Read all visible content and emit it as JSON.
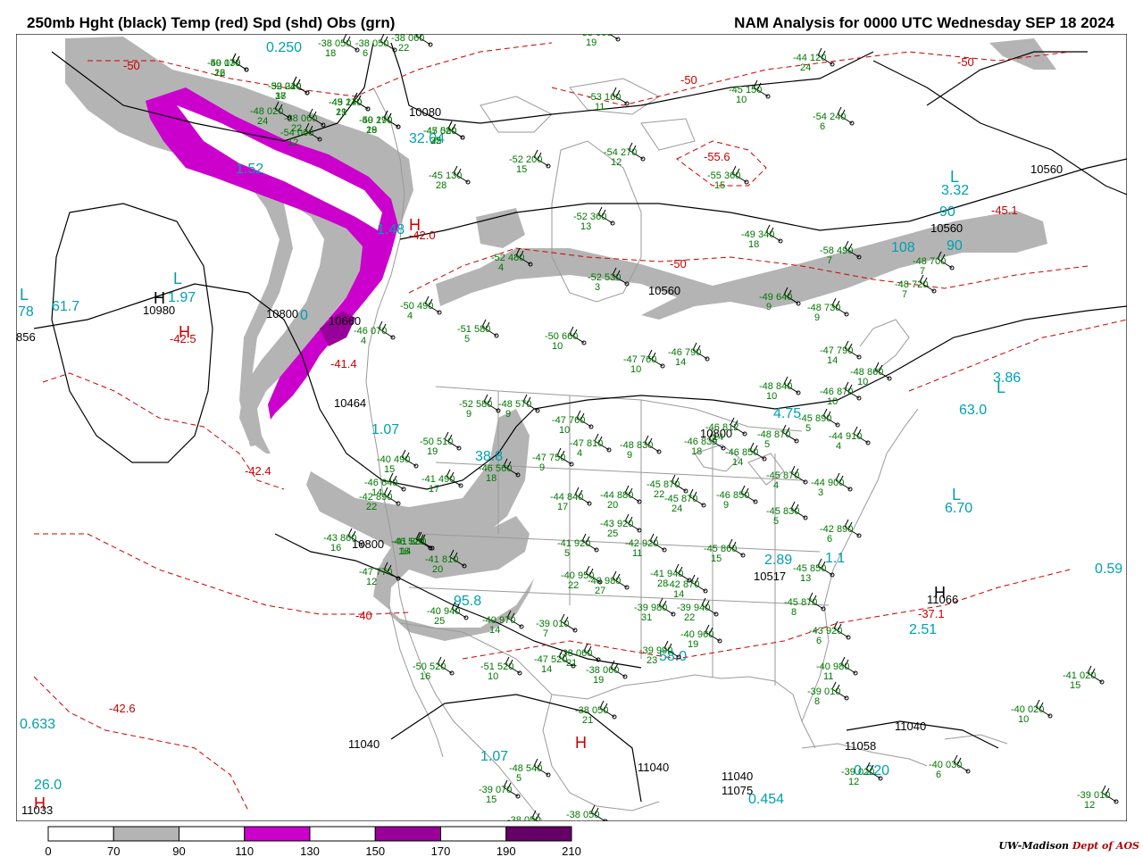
{
  "header": {
    "title_left": "250mb Hght (black) Temp (red) Spd (shd) Obs (grn)",
    "title_right": "NAM Analysis for 0000 UTC Wednesday  SEP 18 2024"
  },
  "legend": {
    "ticks": [
      "0",
      "70",
      "90",
      "110",
      "130",
      "150",
      "170",
      "190",
      "210"
    ],
    "colors": [
      "#ffffff",
      "#b4b4b4",
      "#ffffff",
      "#cc00cc",
      "#ffffff",
      "#990099",
      "#ffffff",
      "#660066"
    ]
  },
  "credit": {
    "institution": "UW-Madison",
    "dept": "Dept of AOS"
  },
  "colors": {
    "height_contours": "#000000",
    "temperature_contours": "#cc0000",
    "observations": "#007700",
    "speed_labels": "#00a0b0",
    "geography": "#9a9a9a",
    "jet_70_90": "#b4b4b4",
    "jet_110_130": "#cc00cc",
    "jet_150_170": "#990099"
  },
  "height_labels": [
    "10560",
    "10560",
    "10560",
    "10800",
    "10800",
    "10800",
    "10980",
    "11040",
    "11040",
    "11040",
    "11040",
    "10080",
    "10660",
    "10464",
    "10517",
    "11066",
    "11058",
    "11075",
    "11033",
    "856"
  ],
  "temperature_labels": [
    "-50",
    "-50",
    "-50",
    "-50",
    "-55.6",
    "-45.1",
    "-42.0",
    "-42.5",
    "-41.4",
    "-42.4",
    "-40",
    "-42.6",
    "-37.1"
  ],
  "hl_markers": [
    "H",
    "H",
    "H",
    "H",
    "H",
    "H",
    "L",
    "L",
    "L",
    "L",
    "L"
  ],
  "speed_labels": [
    "0.250",
    "1.52",
    "1.97",
    "61.7",
    "78",
    "1.48",
    "0",
    "3.32",
    "90",
    "108",
    "90",
    "3.86",
    "63.0",
    "4.75",
    "1.07",
    "38.8",
    "6.70",
    "0.59",
    "2.89",
    "1.1",
    "95.8",
    "58.0",
    "2.51",
    "0.633",
    "26.0",
    "1.07",
    "0.220",
    "0.454",
    "32.04"
  ],
  "observations": [
    [
      "-49 136",
      "26"
    ],
    [
      "-39 040",
      "37"
    ],
    [
      "-45 140",
      "19"
    ],
    [
      "-49 170",
      "19"
    ],
    [
      "-45 080",
      "32"
    ],
    [
      "-45 130",
      "28"
    ],
    [
      "-52 200",
      "15"
    ],
    [
      "-53 160",
      "11"
    ],
    [
      "-54 270",
      "12"
    ],
    [
      "-54 240",
      "6"
    ],
    [
      "-44 120",
      "24"
    ],
    [
      "-45 150",
      "10"
    ],
    [
      "-55 360",
      "15"
    ],
    [
      "-52 360",
      "13"
    ],
    [
      "-49 340",
      "18"
    ],
    [
      "-58 490",
      "7"
    ],
    [
      "-48 700",
      "7"
    ],
    [
      "-48 720",
      "7"
    ],
    [
      "-49 640",
      "9"
    ],
    [
      "-48 730",
      "9"
    ],
    [
      "-52 480",
      "4"
    ],
    [
      "-52 530",
      "3"
    ],
    [
      "-50 490",
      "4"
    ],
    [
      "-51 580",
      "5"
    ],
    [
      "-50 660",
      "10"
    ],
    [
      "-47 760",
      "10"
    ],
    [
      "-46 790",
      "14"
    ],
    [
      "-47 790",
      "14"
    ],
    [
      "-48 860",
      "10"
    ],
    [
      "-48 840",
      "10"
    ],
    [
      "-46 870",
      "10"
    ],
    [
      "-45 890",
      "5"
    ],
    [
      "-48 870",
      "5"
    ],
    [
      "-44 910",
      "4"
    ],
    [
      "-44 900",
      "3"
    ],
    [
      "-45 870",
      "4"
    ],
    [
      "-45 830",
      "5"
    ],
    [
      "-42 890",
      "6"
    ],
    [
      "-45 850",
      "13"
    ],
    [
      "-45 870",
      "8"
    ],
    [
      "-43 920",
      "6"
    ],
    [
      "-40 980",
      "11"
    ],
    [
      "-39 010",
      "8"
    ],
    [
      "-41 020",
      "15"
    ],
    [
      "-40 020",
      "10"
    ],
    [
      "-39 020",
      "12"
    ],
    [
      "-40 030",
      "6"
    ],
    [
      "-39 010",
      "12"
    ],
    [
      "-52 580",
      "9"
    ],
    [
      "-48 570",
      "9"
    ],
    [
      "-47 760",
      "10"
    ],
    [
      "-47 810",
      "4"
    ],
    [
      "-48 830",
      "9"
    ],
    [
      "-46 839",
      "18"
    ],
    [
      "-46 812",
      "14"
    ],
    [
      "-46 850",
      "14"
    ],
    [
      "-45 870",
      "22"
    ],
    [
      "-45 870",
      "24"
    ],
    [
      "-46 850",
      "9"
    ],
    [
      "-45 860",
      "15"
    ],
    [
      "-42 870",
      "14"
    ],
    [
      "-50 510",
      "19"
    ],
    [
      "-46 560",
      "18"
    ],
    [
      "-47 750",
      "9"
    ],
    [
      "-44 840",
      "17"
    ],
    [
      "-44 880",
      "20"
    ],
    [
      "-43 920",
      "25"
    ],
    [
      "-41 920",
      "5"
    ],
    [
      "-42 920",
      "11"
    ],
    [
      "-41 940",
      "28"
    ],
    [
      "-40 950",
      "22"
    ],
    [
      "-40 980",
      "27"
    ],
    [
      "-39 980",
      "31"
    ],
    [
      "-39 940",
      "22"
    ],
    [
      "-40 960",
      "19"
    ],
    [
      "-39 990",
      "23"
    ],
    [
      "-38 060",
      "21"
    ],
    [
      "-38 060",
      "19"
    ],
    [
      "-38 050",
      "21"
    ],
    [
      "-39 010",
      "7"
    ],
    [
      "-40 970",
      "14"
    ],
    [
      "-40 940",
      "25"
    ],
    [
      "-41 810",
      "20"
    ],
    [
      "-41 880",
      "14"
    ],
    [
      "-43 860",
      "16"
    ],
    [
      "-41 490",
      "17"
    ],
    [
      "-47 770",
      "12"
    ],
    [
      "-46 520",
      "16"
    ],
    [
      "-46 640",
      "14"
    ],
    [
      "-40 490",
      "15"
    ],
    [
      "-42 890",
      "22"
    ],
    [
      "-50 520",
      "16"
    ],
    [
      "-51 520",
      "10"
    ],
    [
      "-47 520",
      "14"
    ],
    [
      "-48 540",
      "5"
    ],
    [
      "-39 070",
      "15"
    ],
    [
      "-38 050",
      "17"
    ],
    [
      "-38 050",
      "21"
    ],
    [
      "-38 060",
      "22"
    ],
    [
      "-38 060",
      "19"
    ],
    [
      "-38 050",
      "6"
    ],
    [
      "-38 050",
      "18"
    ],
    [
      "-38 060",
      "22"
    ],
    [
      "-54 060",
      "12"
    ],
    [
      "-48 020",
      "24"
    ],
    [
      "-46 070",
      "4"
    ],
    [
      "-50 070",
      "12"
    ],
    [
      "-52 210",
      "18"
    ],
    [
      "-49 270",
      "21"
    ],
    [
      "-50 290",
      "28"
    ],
    [
      "-47 520",
      "25"
    ]
  ]
}
